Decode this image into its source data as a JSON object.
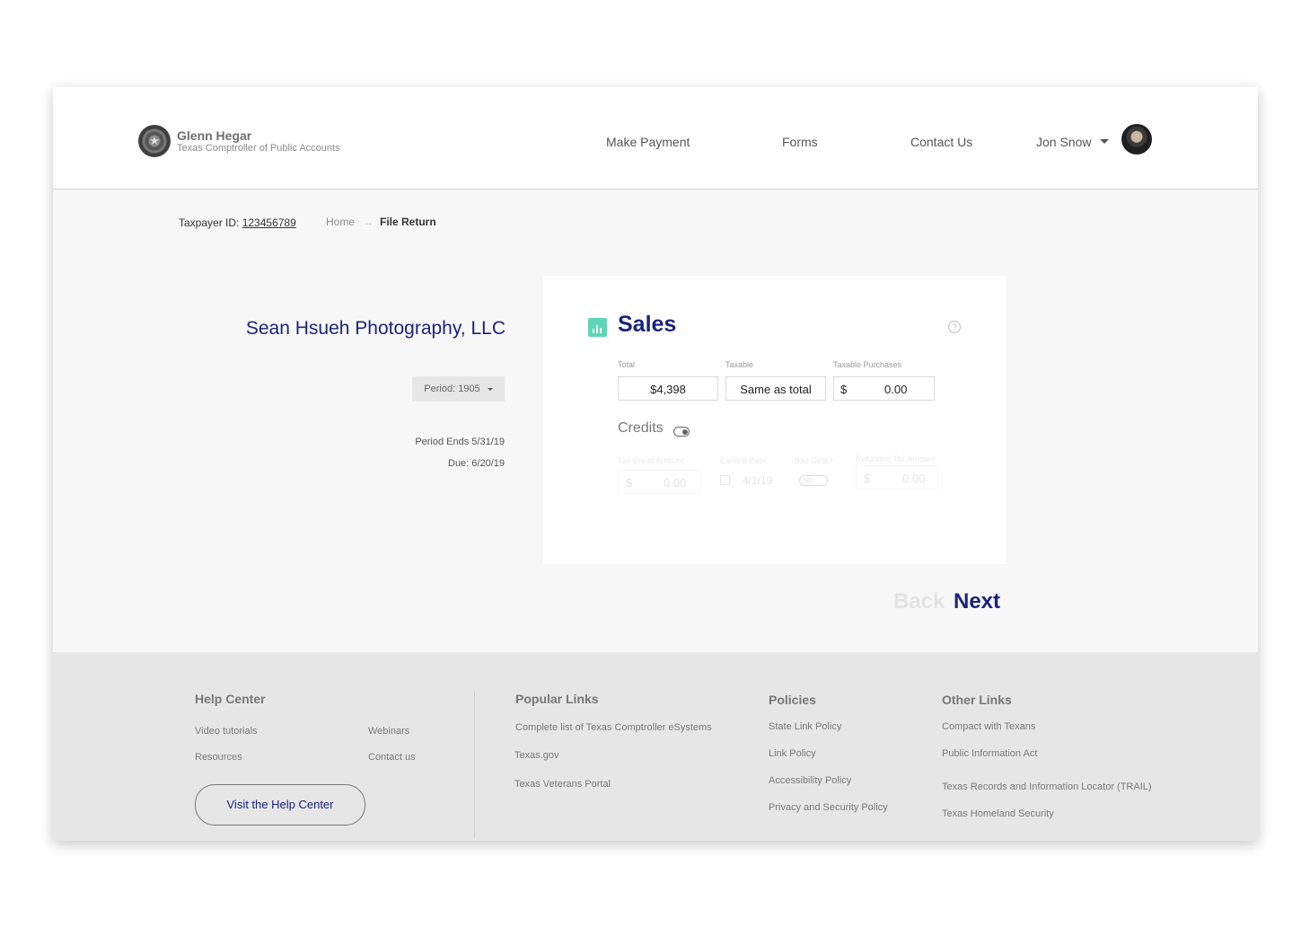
{
  "header": {
    "brand_name": "Glenn Hegar",
    "brand_subtitle": "Texas Comptroller of Public Accounts",
    "nav": [
      "Make Payment",
      "Forms",
      "Contact Us"
    ],
    "user_name": "Jon Snow"
  },
  "breadcrumb": {
    "taxpayer_label": "Taxpayer ID:",
    "taxpayer_id": "123456789",
    "home": "Home",
    "separator": "→",
    "current": "File Return"
  },
  "sidebar": {
    "company": "Sean Hsueh Photography, LLC",
    "period": "Period: 1905",
    "period_ends": "Period Ends 5/31/19",
    "due": "Due: 6/20/19"
  },
  "card": {
    "title": "Sales",
    "help": "?",
    "fields": {
      "total_label": "Total",
      "total_value": "$4,398",
      "taxable_label": "Taxable",
      "taxable_value": "Same as total",
      "purchases_label": "Taxable Purchases",
      "purchases_currency": "$",
      "purchases_value": "0.00"
    },
    "credits": {
      "label": "Credits",
      "enabled": false,
      "tax_credit_label": "Tax Credit Amount",
      "tax_credit_currency": "$",
      "tax_credit_value": "0.00",
      "earliest_date_label": "Earliest Date",
      "earliest_date_value": "4/1/19",
      "bad_debt_label": "Bad Debt?",
      "bad_debt_value": "NO",
      "refunded_label": "Refunded Tax Amount",
      "refunded_currency": "$",
      "refunded_value": "0.00"
    }
  },
  "actions": {
    "back": "Back",
    "next": "Next"
  },
  "footer": {
    "help_center": {
      "title": "Help Center",
      "links": [
        "Video tutorials",
        "Webinars",
        "Resources",
        "Contact us"
      ],
      "button": "Visit the Help Center"
    },
    "popular": {
      "title": "Popular Links",
      "links": [
        "Complete list of Texas Comptroller eSystems",
        "Texas.gov",
        "Texas Veterans Portal"
      ]
    },
    "policies": {
      "title": "Policies",
      "links": [
        "State Link Policy",
        "Link Policy",
        "Accessibility Policy",
        "Privacy and Security Policy"
      ]
    },
    "other": {
      "title": "Other Links",
      "links": [
        "Compact with Texans",
        "Public Information Act",
        "Texas Records and Information Locator (TRAIL)",
        "Texas Homeland Security"
      ]
    }
  },
  "colors": {
    "accent": "#1a237e",
    "icon_green": "#5fd6b5",
    "footer_bg": "#e6e6e6"
  }
}
